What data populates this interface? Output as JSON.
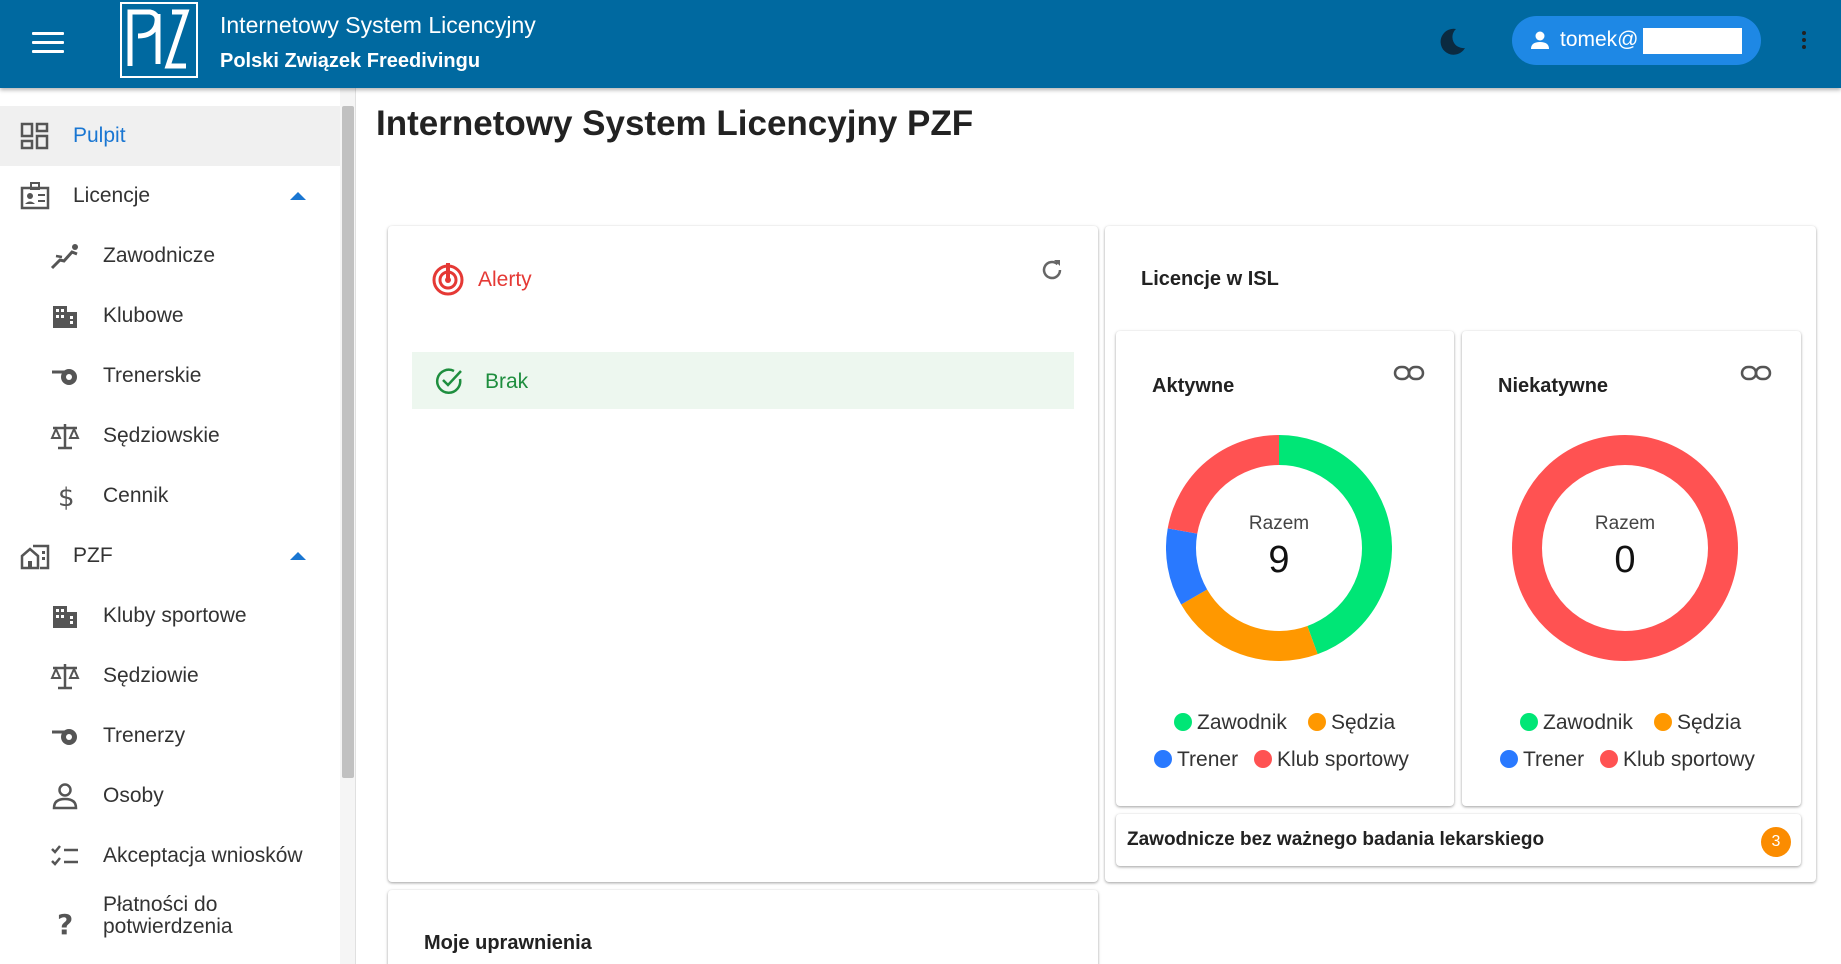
{
  "header": {
    "title": "Internetowy System Licencyjny",
    "subtitle": "Polski Związek Freedivingu",
    "user_label": "tomek@",
    "brand_color": "#0069a0"
  },
  "sidebar": {
    "items": [
      {
        "label": "Pulpit",
        "icon": "dashboard-icon"
      },
      {
        "label": "Licencje",
        "icon": "license-badge-icon"
      },
      {
        "label": "Zawodnicze",
        "icon": "diver-icon"
      },
      {
        "label": "Klubowe",
        "icon": "building-icon"
      },
      {
        "label": "Trenerskie",
        "icon": "whistle-icon"
      },
      {
        "label": "Sędziowskie",
        "icon": "scales-icon"
      },
      {
        "label": "Cennik",
        "icon": "dollar-icon"
      },
      {
        "label": "PZF",
        "icon": "home-work-icon"
      },
      {
        "label": "Kluby sportowe",
        "icon": "building-icon"
      },
      {
        "label": "Sędziowie",
        "icon": "scales-icon"
      },
      {
        "label": "Trenerzy",
        "icon": "whistle-icon"
      },
      {
        "label": "Osoby",
        "icon": "person-icon"
      },
      {
        "label": "Akceptacja wniosków",
        "icon": "checklist-icon"
      },
      {
        "label": "Płatności do potwierdzenia",
        "icon": "question-icon"
      }
    ]
  },
  "main": {
    "page_title": "Internetowy System Licencyjny PZF",
    "alerts": {
      "title": "Alerty",
      "status": "Brak"
    },
    "licenses": {
      "title": "Licencje w ISL",
      "active": {
        "title": "Aktywne",
        "razem_label": "Razem",
        "total": "9"
      },
      "inactive": {
        "title": "Niekatywne",
        "razem_label": "Razem",
        "total": "0"
      },
      "legend": {
        "zawodnik": "Zawodnik",
        "sedzia": "Sędzia",
        "trener": "Trener",
        "klub": "Klub sportowy"
      }
    },
    "medical": {
      "label": "Zawodnicze bez ważnego badania lekarskiego",
      "count": "3"
    },
    "permissions": {
      "title": "Moje uprawnienia"
    }
  },
  "chart_data": [
    {
      "type": "pie",
      "title": "Aktywne",
      "categories": [
        "Zawodnik",
        "Sędzia",
        "Trener",
        "Klub sportowy"
      ],
      "values": [
        4,
        2,
        1,
        2
      ],
      "colors": [
        "#00e676",
        "#ff9800",
        "#2979ff",
        "#ff5252"
      ],
      "total": 9,
      "legend": "bottom"
    },
    {
      "type": "pie",
      "title": "Niekatywne",
      "categories": [
        "Zawodnik",
        "Sędzia",
        "Trener",
        "Klub sportowy"
      ],
      "values": [
        0,
        0,
        0,
        0
      ],
      "colors": [
        "#00e676",
        "#ff9800",
        "#2979ff",
        "#ff5252"
      ],
      "total": 0,
      "legend": "bottom"
    }
  ]
}
